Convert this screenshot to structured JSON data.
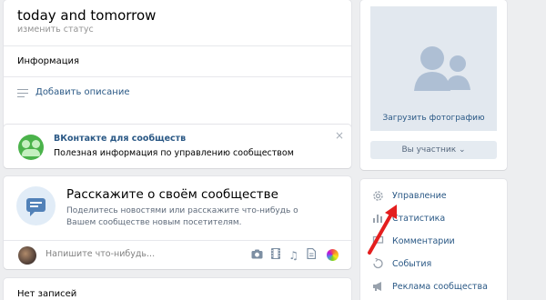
{
  "header": {
    "group_name": "today and tomorrow",
    "status_link": "изменить статус",
    "info_label": "Информация",
    "add_description": "Добавить описание"
  },
  "promo": {
    "title": "ВКонтакте для сообществ",
    "subtitle": "Полезная информация по управлению сообществом",
    "close": "×"
  },
  "tell": {
    "title": "Расскажите о своём сообществе",
    "subtitle": "Поделитесь новостями или расскажите что-нибудь о Вашем сообществе новым посетителям."
  },
  "composer": {
    "placeholder": "Напишите что-нибудь..."
  },
  "wall": {
    "no_posts": "Нет записей"
  },
  "sidebar": {
    "upload_photo": "Загрузить фотографию",
    "member_button": "Вы участник ⌄",
    "menu": [
      {
        "label": "Управление",
        "icon": "gear-icon"
      },
      {
        "label": "Статистика",
        "icon": "stats-icon"
      },
      {
        "label": "Комментарии",
        "icon": "comments-icon"
      },
      {
        "label": "События",
        "icon": "events-icon"
      },
      {
        "label": "Реклама сообщества",
        "icon": "megaphone-icon"
      }
    ]
  },
  "colors": {
    "link": "#2a5885",
    "accent": "#5181b8",
    "background": "#edeef0",
    "annotation_arrow": "#e41e1e"
  }
}
